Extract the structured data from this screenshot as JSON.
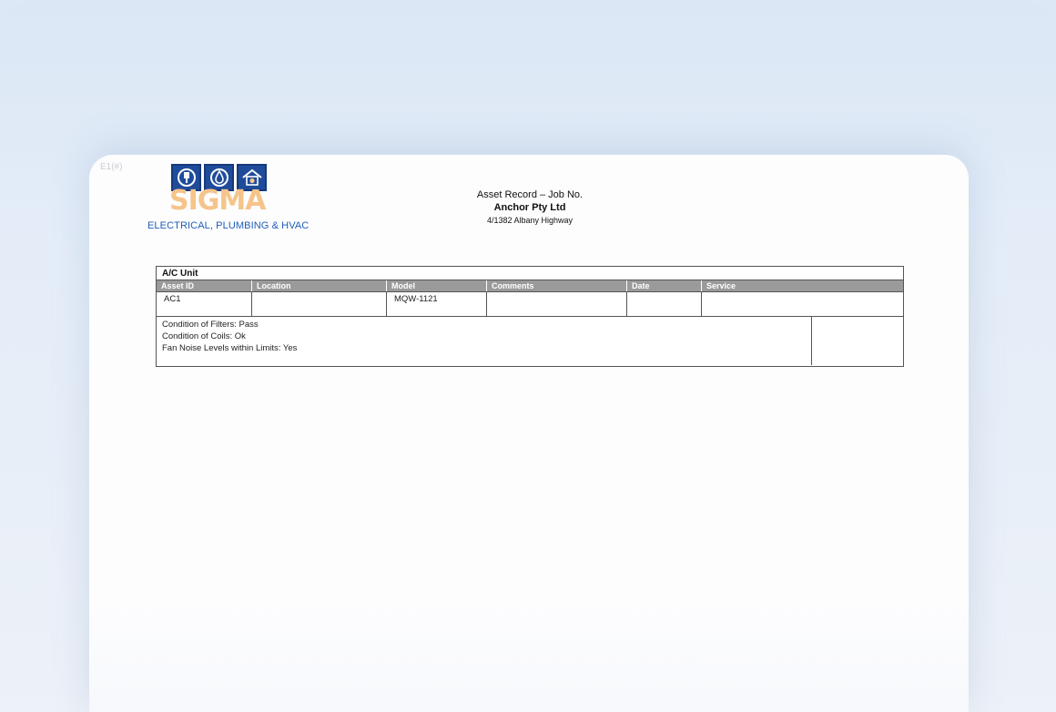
{
  "page_tag": "E1(#)",
  "logo": {
    "word": "SIGMA",
    "subtitle": "ELECTRICAL, PLUMBING & HVAC",
    "icons": [
      "electrical-plug-icon",
      "water-drop-icon",
      "hvac-house-icon"
    ],
    "colors": {
      "icon_bg": "#1f4c9a",
      "word": "#f6c48a",
      "subtitle": "#1f5db8"
    }
  },
  "header": {
    "title": "Asset Record – Job No.",
    "company": "Anchor Pty Ltd",
    "address": "4/1382 Albany Highway"
  },
  "asset_section": {
    "title": "A/C Unit",
    "columns": [
      "Asset ID",
      "Location",
      "Model",
      "Comments",
      "Date",
      "Service"
    ],
    "row": {
      "asset_id": "AC1",
      "location": "",
      "model": "MQW-1121",
      "comments": "",
      "date": "",
      "service": ""
    },
    "notes": [
      "Condition of Filters: Pass",
      "Condition of Coils: Ok",
      "Fan Noise Levels within Limits: Yes"
    ],
    "header_color": "#9a9a9a"
  }
}
